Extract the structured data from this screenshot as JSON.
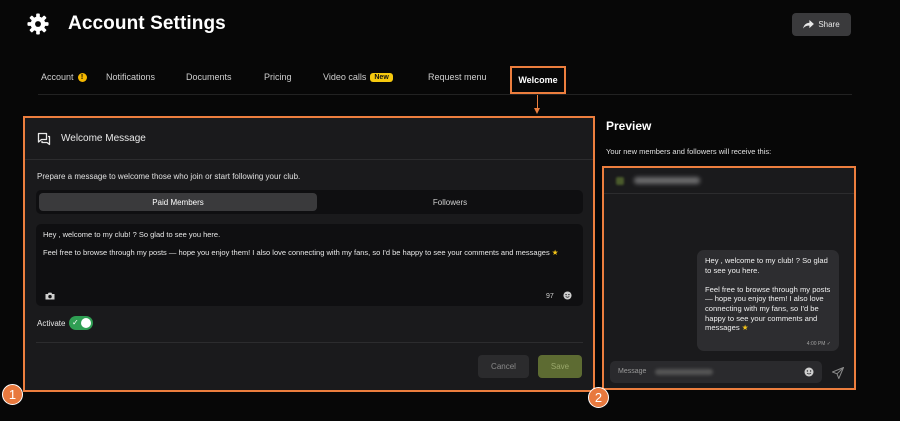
{
  "header": {
    "title": "Account Settings",
    "icon": "gear-icon",
    "share_label": "Share"
  },
  "tabs": [
    {
      "label": "Account",
      "badge_icon": "warning-icon"
    },
    {
      "label": "Notifications"
    },
    {
      "label": "Documents"
    },
    {
      "label": "Pricing"
    },
    {
      "label": "Video calls",
      "badge": "New"
    },
    {
      "label": "Request menu"
    },
    {
      "label": "Welcome",
      "active": true
    }
  ],
  "welcome_panel": {
    "title": "Welcome Message",
    "description": "Prepare a message to welcome those who join or start following your club.",
    "segments": [
      "Paid Members",
      "Followers"
    ],
    "selected_segment": "Paid Members",
    "message_line1": "Hey , welcome to my club! ? So glad to see you here.",
    "message_line2": "Feel free to browse through my posts — hope you enjoy them! I also love connecting with my fans, so I'd be happy to see your comments and messages",
    "star": "★",
    "char_count": "97",
    "activate_label": "Activate",
    "activate_on": true,
    "cancel_label": "Cancel",
    "save_label": "Save"
  },
  "preview": {
    "title": "Preview",
    "description": "Your new members and followers will receive this:",
    "bubble_para1": "Hey , welcome to my club! ? So glad to see you here.",
    "bubble_para2": "Feel free to browse through my posts — hope you enjoy them! I also love connecting with my fans, so I'd be happy to see your comments and messages",
    "star": "★",
    "time": "4:00 PM",
    "check": "✓",
    "input_placeholder": "Message"
  },
  "markers": [
    "1",
    "2"
  ],
  "colors": {
    "highlight": "#ec7e3e",
    "marker": "#e8793e",
    "toggle_on": "#2f9e53",
    "save": "#5d6b32",
    "badge_new": "#f6c90e",
    "warning": "#f5b800"
  }
}
